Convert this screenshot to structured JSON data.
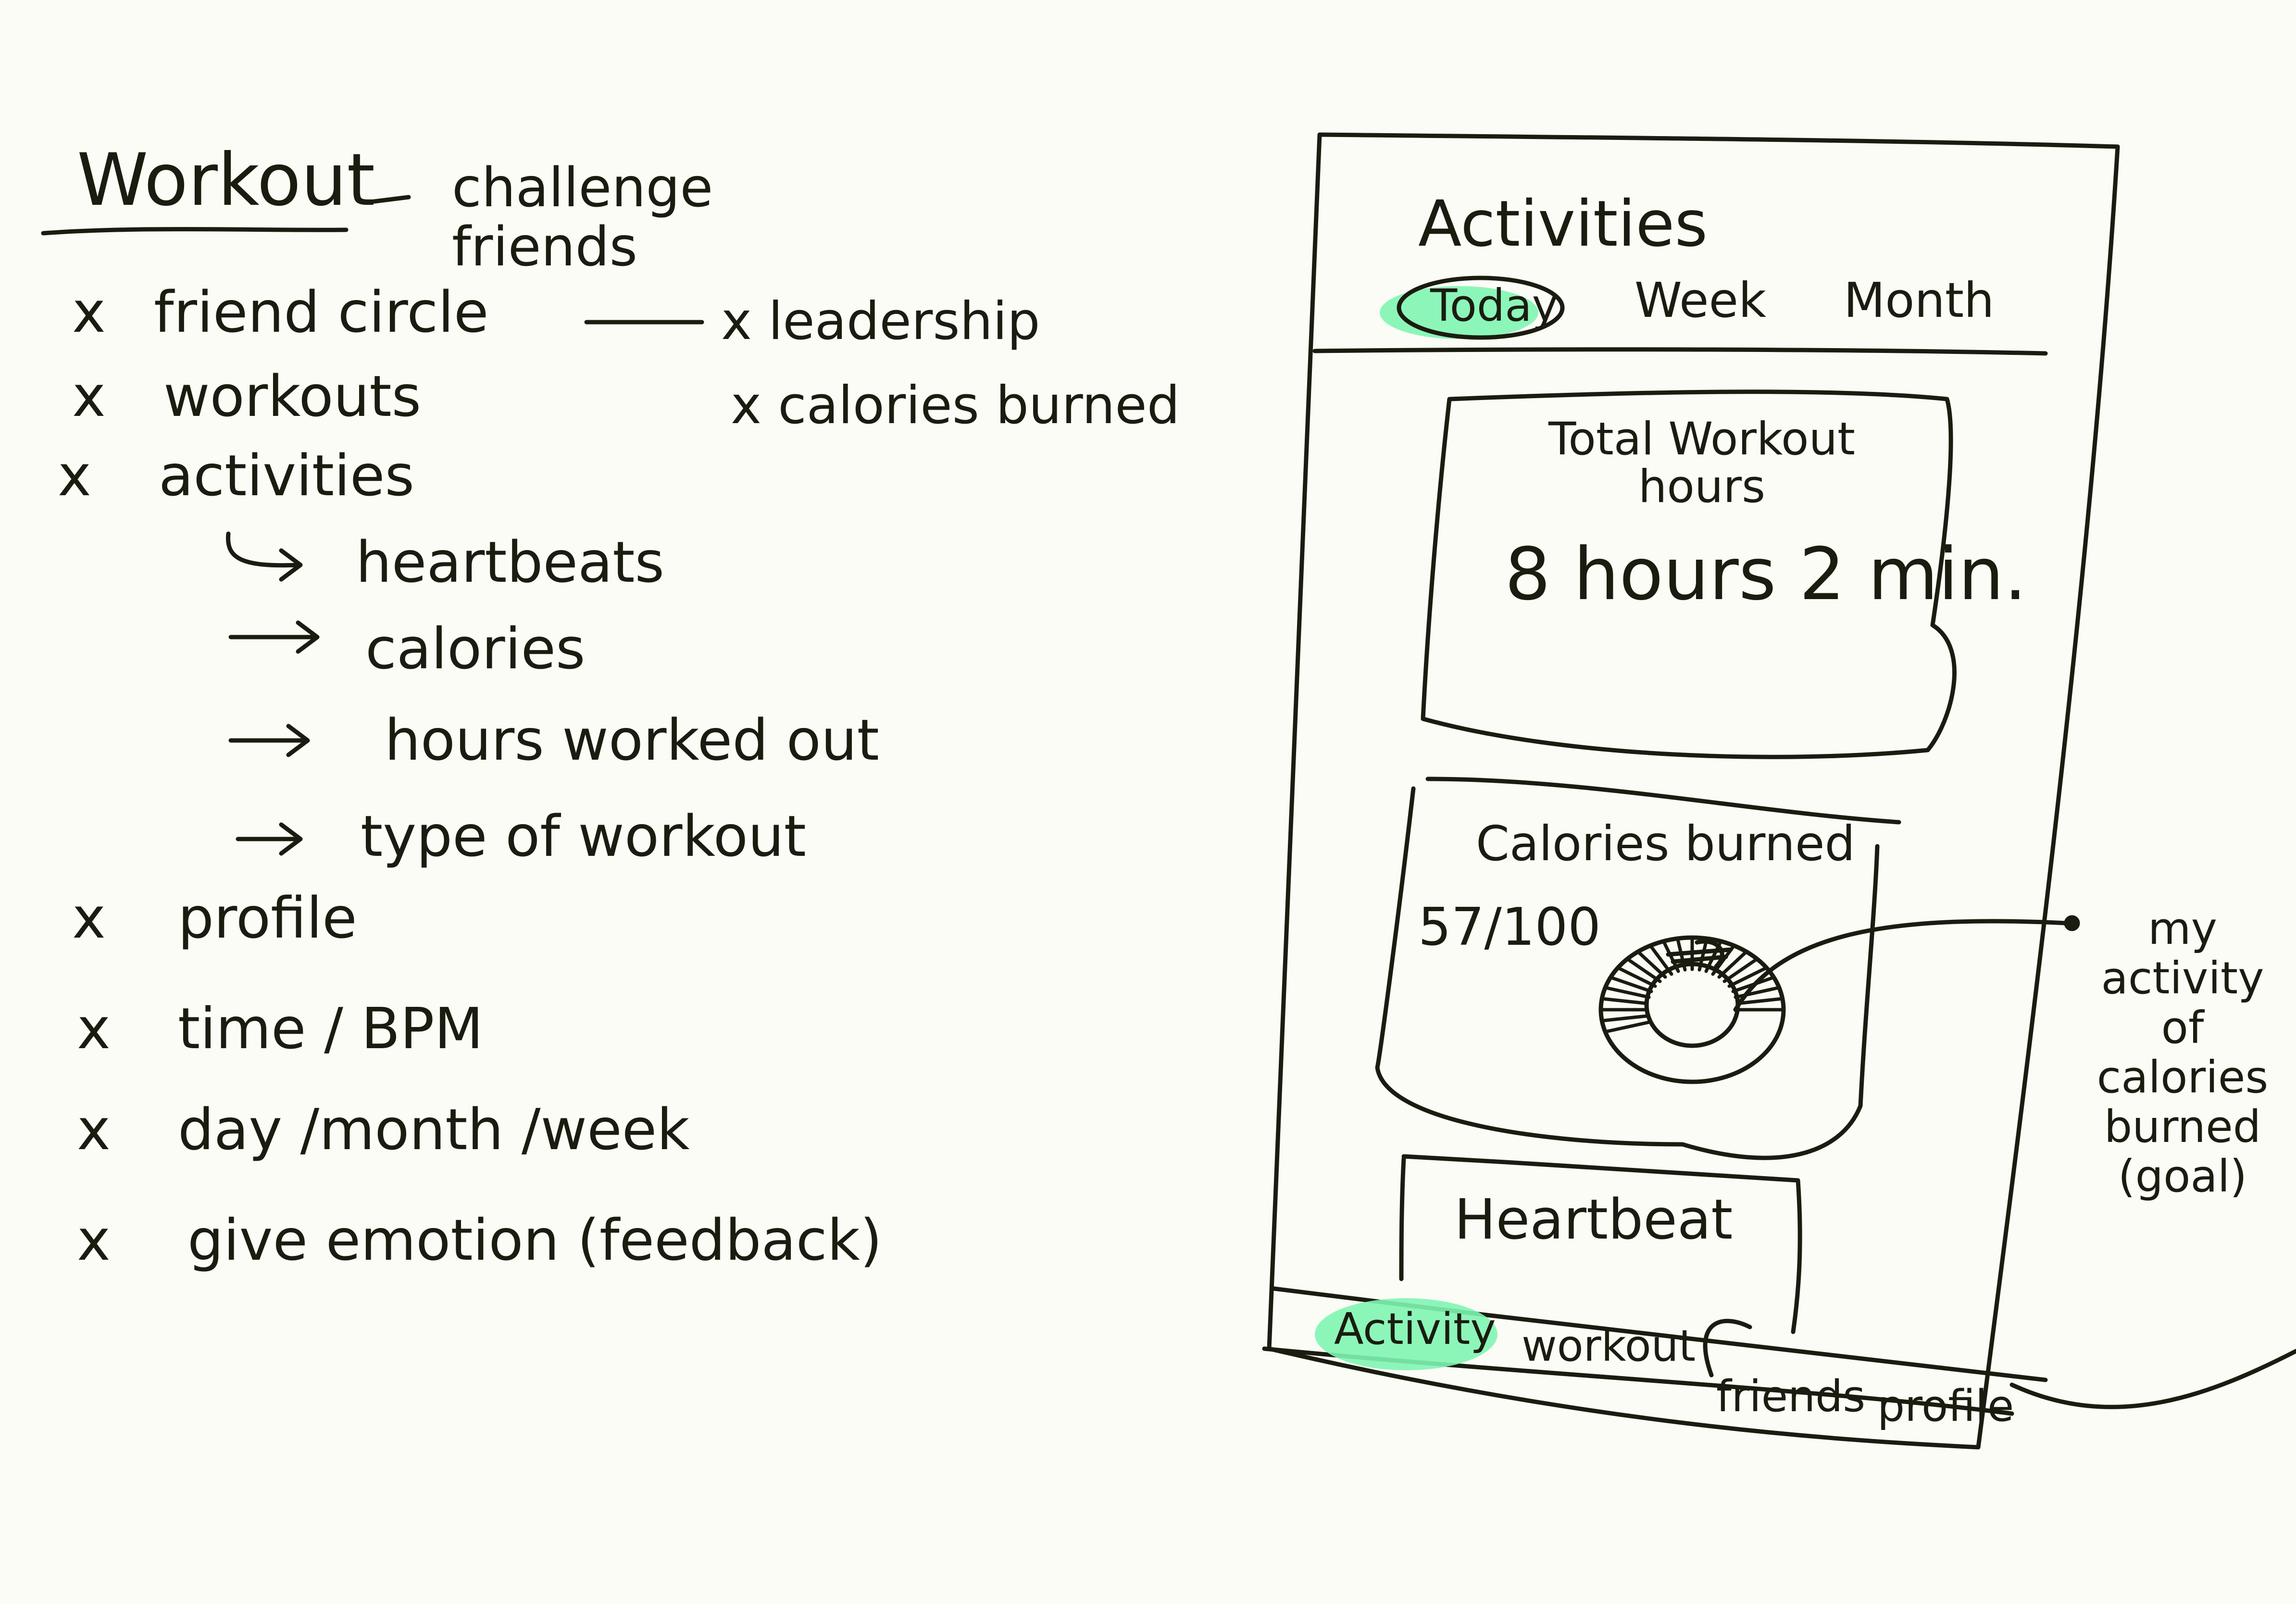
{
  "notes": {
    "title": "Workout",
    "title_aside": "challenge friends",
    "items": [
      {
        "mark": "x",
        "label": "friend circle"
      },
      {
        "mark": "x",
        "label": "workouts"
      },
      {
        "mark": "x",
        "label": "activities"
      },
      {
        "mark": "x",
        "label": "profile"
      },
      {
        "mark": "x",
        "label": "time / BPM"
      },
      {
        "mark": "x",
        "label": "day /month /week"
      },
      {
        "mark": "x",
        "label": "give emotion (feedback)"
      }
    ],
    "friend_circle_sub": [
      "x leadership",
      "x calories burned"
    ],
    "activities_sub": [
      "heartbeats",
      "calories",
      "hours worked out",
      "type of workout"
    ]
  },
  "phone": {
    "header_title": "Activities",
    "tabs": [
      "Today",
      "Week",
      "Month"
    ],
    "active_tab": "Today",
    "card_hours": {
      "title": "Total Workout hours",
      "value": "8 hours 2 min."
    },
    "card_calories": {
      "title": "Calories burned",
      "value": "57/100",
      "progress": 0.57
    },
    "card_heartbeat": {
      "title": "Heartbeat"
    },
    "bottom_nav": [
      "Activity",
      "workout",
      "friends",
      "profile"
    ],
    "active_nav": "Activity"
  },
  "annotation": "my activity of calories burned (goal)",
  "colors": {
    "ink": "#1b1c10",
    "paper": "#fbfcf5",
    "highlight": "#7ff5b3"
  }
}
